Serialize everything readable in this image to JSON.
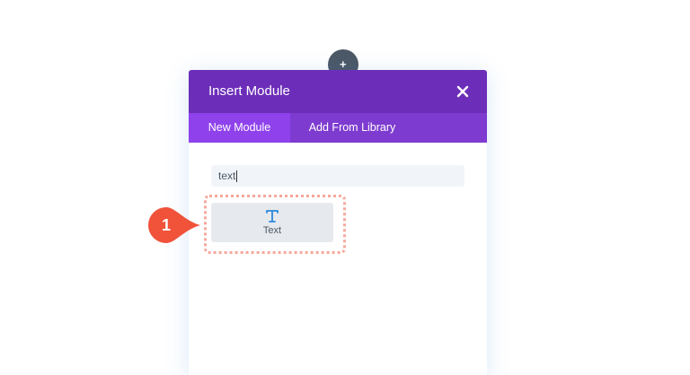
{
  "modal": {
    "title": "Insert Module",
    "close_icon": "close-icon"
  },
  "tabs": [
    {
      "label": "New Module",
      "active": true
    },
    {
      "label": "Add From Library",
      "active": false
    }
  ],
  "search": {
    "value": "text"
  },
  "modules": [
    {
      "label": "Text",
      "icon": "text-type-icon"
    }
  ],
  "annotation": {
    "step": "1"
  },
  "colors": {
    "header": "#6c2eb9",
    "tabs_bar": "#7e3bd0",
    "tab_active": "#8f42ec",
    "text_icon": "#2b87da",
    "step_marker": "#f0523a",
    "highlight_outline": "#f7a89b",
    "add_button": "#4c5866"
  }
}
